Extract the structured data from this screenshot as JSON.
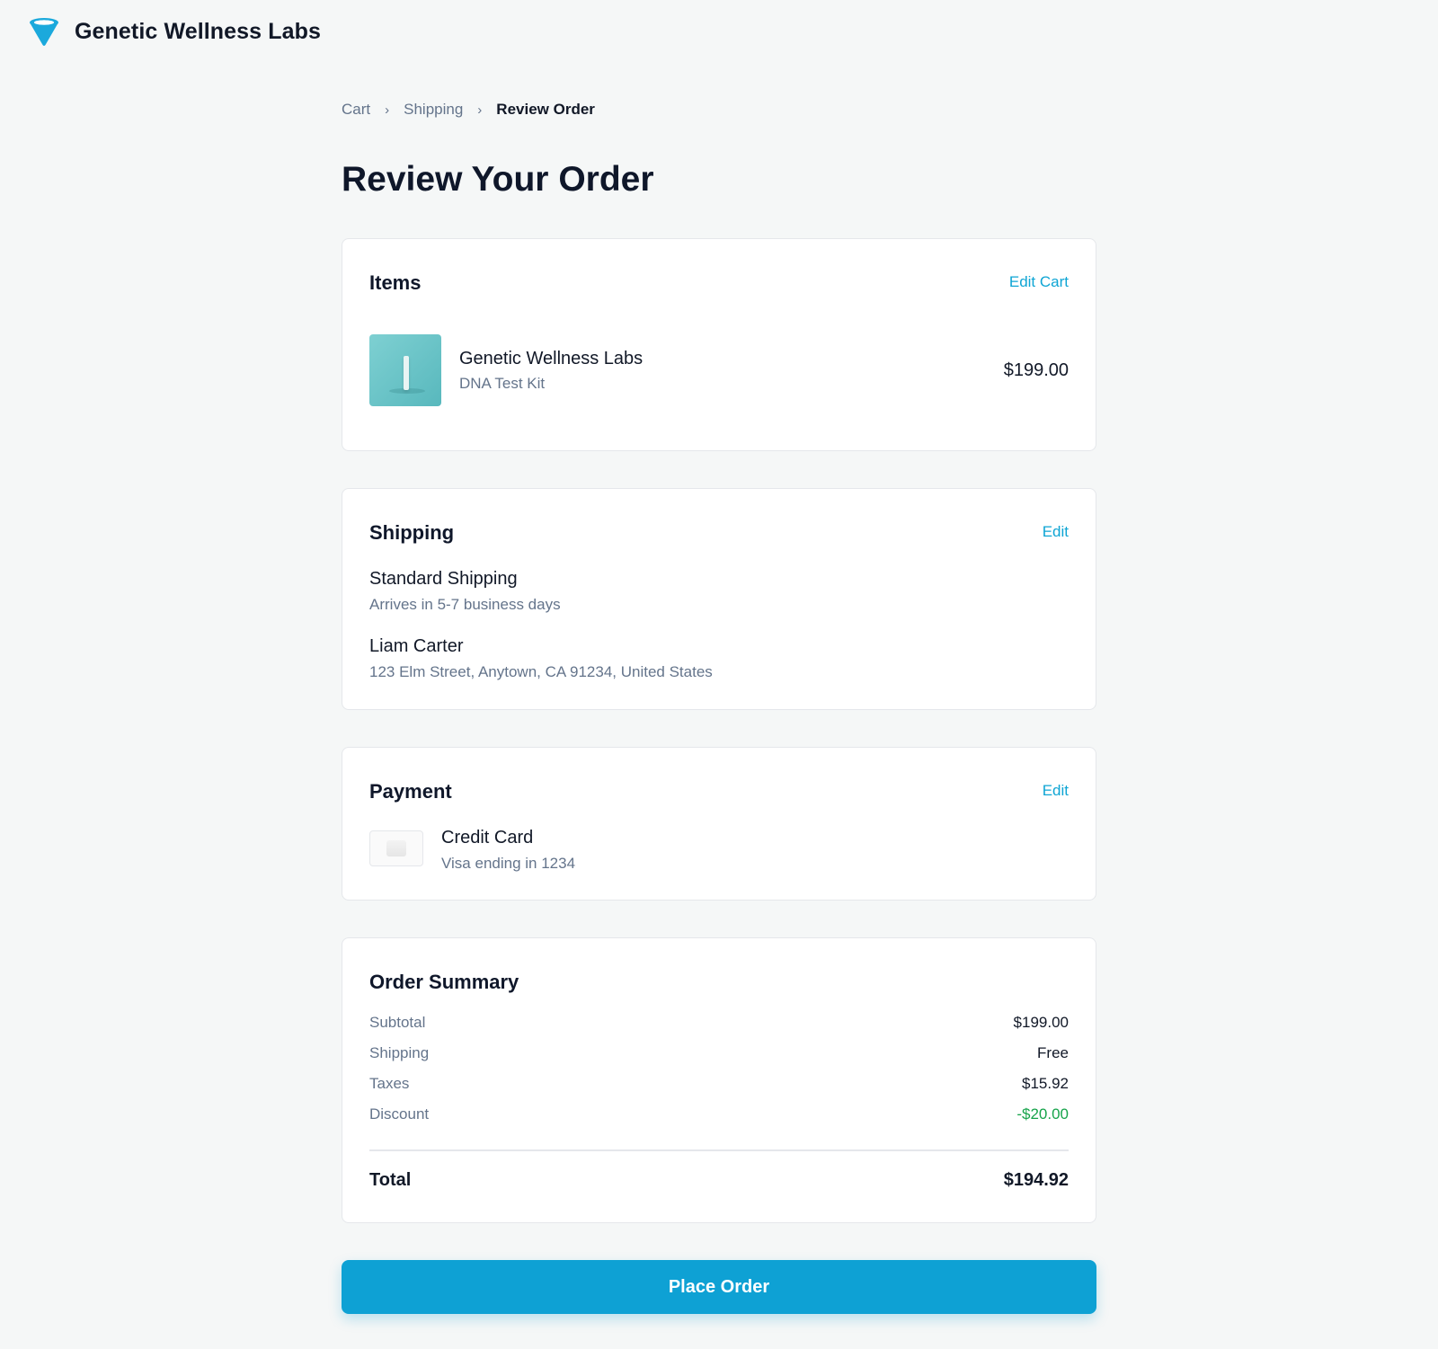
{
  "header": {
    "brand_name": "Genetic Wellness Labs",
    "logo_icon": "funnel-drop-icon",
    "accent_color": "#0ea1d4"
  },
  "breadcrumb": {
    "items": [
      "Cart",
      "Shipping",
      "Review Order"
    ],
    "separator": "›"
  },
  "page_title": "Review Your Order",
  "items_section": {
    "title": "Items",
    "edit_label": "Edit Cart",
    "product": {
      "name": "Genetic Wellness Labs",
      "subtitle": "DNA Test Kit",
      "price": "$199.00",
      "thumbnail_icon": "dna-kit-tube-image"
    }
  },
  "shipping_section": {
    "title": "Shipping",
    "edit_label": "Edit",
    "method": "Standard Shipping",
    "eta": "Arrives in 5-7 business days",
    "recipient": "Liam Carter",
    "address": "123 Elm Street, Anytown, CA 91234, United States"
  },
  "payment_section": {
    "title": "Payment",
    "edit_label": "Edit",
    "method": "Credit Card",
    "detail": "Visa ending in 1234",
    "card_icon": "credit-card-icon"
  },
  "summary_section": {
    "title": "Order Summary",
    "rows": [
      {
        "label": "Subtotal",
        "value": "$199.00"
      },
      {
        "label": "Shipping",
        "value": "Free"
      },
      {
        "label": "Taxes",
        "value": "$15.92"
      },
      {
        "label": "Discount",
        "value": "-$20.00"
      }
    ],
    "total_label": "Total",
    "total_value": "$194.92",
    "discount_color": "#16a34a"
  },
  "place_order_label": "Place Order"
}
